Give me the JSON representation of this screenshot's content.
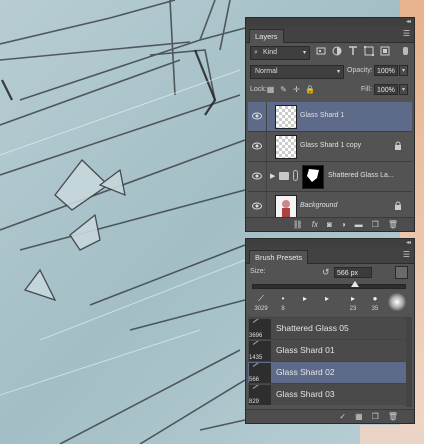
{
  "layers_panel": {
    "tab_label": "Layers",
    "kind_filter": "Kind",
    "blend_mode": "Normal",
    "opacity_label": "Opacity:",
    "opacity_value": "100%",
    "lock_label": "Lock:",
    "fill_label": "Fill:",
    "fill_value": "100%",
    "layers": [
      {
        "name": "Glass Shard 1",
        "selected": true,
        "locked": false
      },
      {
        "name": "Glass Shard 1 copy",
        "selected": false,
        "locked": true
      },
      {
        "name": "Shattered Glass La...",
        "selected": false,
        "locked": false,
        "group": true
      },
      {
        "name": "Background",
        "selected": false,
        "locked": true,
        "italic": true
      }
    ],
    "footer_icons": [
      "link-icon",
      "fx-icon",
      "mask-icon",
      "adjustment-icon",
      "folder-icon",
      "new-layer-icon",
      "trash-icon"
    ]
  },
  "brush_panel": {
    "tab_label": "Brush Presets",
    "size_label": "Size:",
    "size_value": "566 px",
    "tip_numbers": [
      "3029",
      "8",
      "",
      "",
      "23",
      "35",
      ""
    ],
    "presets": [
      {
        "number": "3696",
        "name": "Shattered Glass 05",
        "selected": false
      },
      {
        "number": "1435",
        "name": "Glass Shard 01",
        "selected": false
      },
      {
        "number": "566",
        "name": "Glass Shard 02",
        "selected": true
      },
      {
        "number": "829",
        "name": "Glass Shard 03",
        "selected": false
      }
    ]
  },
  "colors": {
    "panel_bg": "#535353",
    "selection": "#5e6a8a",
    "canvas_base": "#a9c4cc"
  }
}
